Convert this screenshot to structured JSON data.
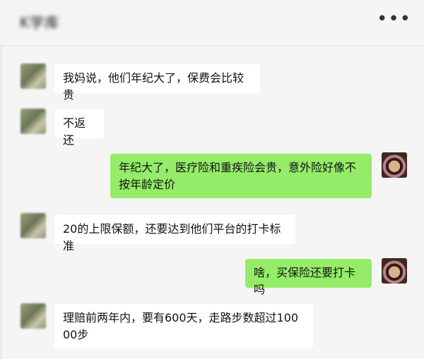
{
  "header": {
    "title": "K学库",
    "more_label": "•••"
  },
  "messages": [
    {
      "from": "other",
      "text": "我妈说，他们年纪大了，保费会比较贵"
    },
    {
      "from": "other",
      "text": "不返还"
    },
    {
      "from": "me",
      "text": "年纪大了，医疗险和重疾险会贵，意外险好像不按年龄定价"
    },
    {
      "from": "other",
      "text": "20的上限保额，还要达到他们平台的打卡标准"
    },
    {
      "from": "me",
      "text": "啥，买保险还要打卡吗"
    },
    {
      "from": "other",
      "text": "理赔前两年内，要有600天，走路步数超过10000步"
    }
  ],
  "colors": {
    "sent_bubble": "#95ec69",
    "received_bubble": "#ffffff",
    "background": "#f5f5f5"
  }
}
